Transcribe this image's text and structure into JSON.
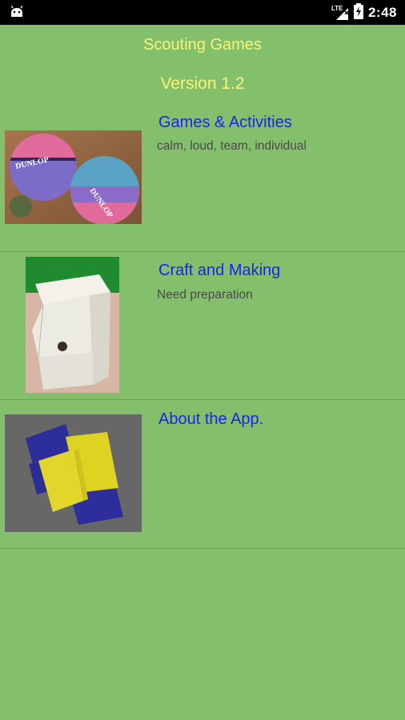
{
  "status_bar": {
    "network": "LTE",
    "time": "2:48"
  },
  "app": {
    "title": "Scouting Games",
    "version": "Version 1.2"
  },
  "menu": [
    {
      "label": "Games & Activities",
      "description": "calm, loud, team, individual",
      "image": "basketballs"
    },
    {
      "label": "Craft and Making",
      "description": "Need preparation",
      "image": "birdhouse"
    },
    {
      "label": "About the App.",
      "description": "",
      "image": "beanbags"
    }
  ],
  "colors": {
    "background": "#84bf6c",
    "title": "#f6f57a",
    "link": "#1d23ef",
    "description": "#4a4a4a"
  }
}
